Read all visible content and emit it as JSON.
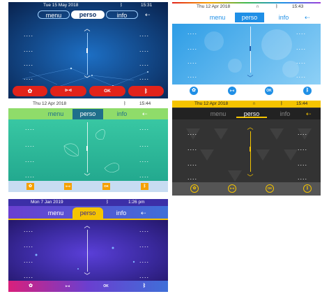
{
  "tabs": {
    "menu": "menu",
    "perso": "perso",
    "info": "info"
  },
  "exit_glyph": "⇠",
  "bluetooth_glyph": "ᛒ",
  "headset_glyph": "∩",
  "dots": "....",
  "chevron_up": "︿",
  "chevron_down": "﹀",
  "buttons": {
    "settings": "✿",
    "mute": "⊳⊲",
    "ok": "OK",
    "bluetooth": "ᛒ"
  },
  "panels": {
    "p1": {
      "date": "Tue 15 May 2018",
      "time": "15:31"
    },
    "p2": {
      "date": "Thu 12 Apr 2018",
      "time": "15:43"
    },
    "p3": {
      "date": "Thu 12 Apr 2018",
      "time": "15:44"
    },
    "p4": {
      "date": "Thu 12 Apr 2018",
      "time": "15:44"
    },
    "p5": {
      "date": "Mon 7 Jan 2019",
      "time": "1:26 pm"
    }
  },
  "colors": {
    "blue_theme": "#0b3b7a",
    "red_buttons": "#e2231a",
    "light_theme": "#4fb4ea",
    "green_theme": "#2fbf9f",
    "green_header": "#8fdc6a",
    "dark_theme": "#3a3a3a",
    "yellow_accent": "#f5c400",
    "purple_theme": "#4b2c9a",
    "pink_bar": "#d9207c"
  }
}
